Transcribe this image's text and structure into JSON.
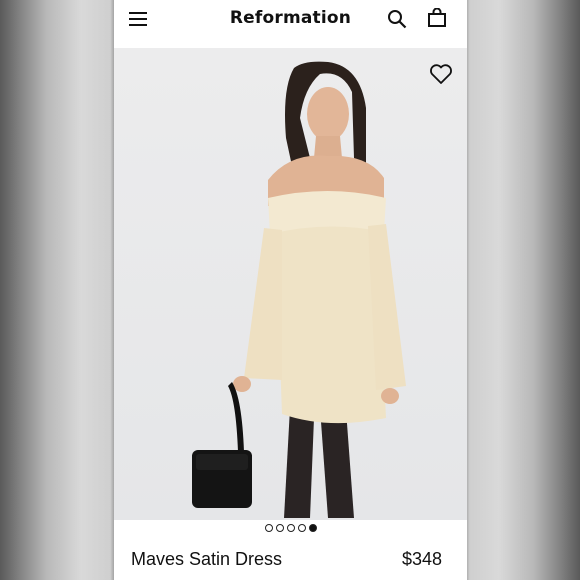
{
  "header": {
    "brand": "Reformation",
    "icons": [
      "menu-icon",
      "search-icon",
      "shopping-bag-icon"
    ]
  },
  "gallery": {
    "favorite_icon": "heart-icon",
    "image_count": 5,
    "active_index": 4
  },
  "product": {
    "name": "Maves Satin Dress",
    "price": "$348"
  },
  "colors": {
    "dress": "#efe3c6",
    "text": "#111111"
  }
}
